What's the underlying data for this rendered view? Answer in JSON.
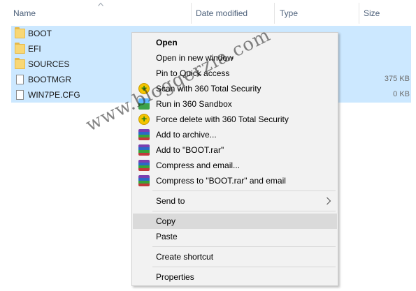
{
  "columns": {
    "name": "Name",
    "date_modified": "Date modified",
    "type": "Type",
    "size": "Size"
  },
  "files": [
    {
      "name": "BOOT",
      "kind": "folder",
      "size": ""
    },
    {
      "name": "EFI",
      "kind": "folder",
      "size": ""
    },
    {
      "name": "SOURCES",
      "kind": "folder",
      "size": ""
    },
    {
      "name": "BOOTMGR",
      "kind": "file",
      "size": "375 KB"
    },
    {
      "name": "WIN7PE.CFG",
      "kind": "file",
      "size": "0 KB"
    }
  ],
  "context_menu": {
    "open": "Open",
    "open_new_window": "Open in new window",
    "pin_quick_access": "Pin to Quick access",
    "scan_360": "Scan with 360 Total Security",
    "run_sandbox": "Run in 360 Sandbox",
    "force_delete": "Force delete with 360 Total Security",
    "add_archive": "Add to archive...",
    "add_boot_rar": "Add to \"BOOT.rar\"",
    "compress_email": "Compress and email...",
    "compress_boot_email": "Compress to \"BOOT.rar\" and email",
    "send_to": "Send to",
    "copy": "Copy",
    "paste": "Paste",
    "create_shortcut": "Create shortcut",
    "properties": "Properties"
  },
  "icons": {
    "folder": "folder-icon",
    "file": "file-icon",
    "scan": "security-360-icon",
    "sandbox": "sandbox-icon",
    "archive": "winrar-icon"
  },
  "colors": {
    "selection": "#cce8ff",
    "menu_bg": "#f2f2f2",
    "menu_hover": "#dadada",
    "header_text": "#4c607a"
  },
  "watermark": "www.bloggerzia.com"
}
